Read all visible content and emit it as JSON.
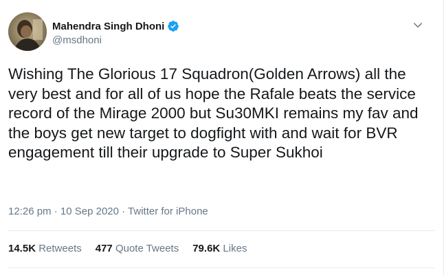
{
  "author": {
    "display_name": "Mahendra Singh Dhoni",
    "handle": "@msdhoni",
    "verified": true
  },
  "tweet": {
    "text": "Wishing The Glorious 17 Squadron(Golden Arrows) all the very best and for all of us hope the Rafale beats the service record of the Mirage 2000 but Su30MKI remains my fav and the boys get new target to dogfight with and wait for BVR engagement till their upgrade to Super Sukhoi"
  },
  "meta": {
    "time": "12:26 pm",
    "separator": " · ",
    "date": "10 Sep 2020",
    "source": "Twitter for iPhone"
  },
  "stats": {
    "retweets_count": "14.5K",
    "retweets_label": "Retweets",
    "quotes_count": "477",
    "quotes_label": "Quote Tweets",
    "likes_count": "79.6K",
    "likes_label": "Likes"
  },
  "icons": {
    "verified": "verified-badge-icon",
    "caret": "chevron-down-icon"
  },
  "colors": {
    "accent": "#1da1f2",
    "text_primary": "#14171a",
    "text_secondary": "#657786",
    "divider": "#e6ecf0"
  }
}
